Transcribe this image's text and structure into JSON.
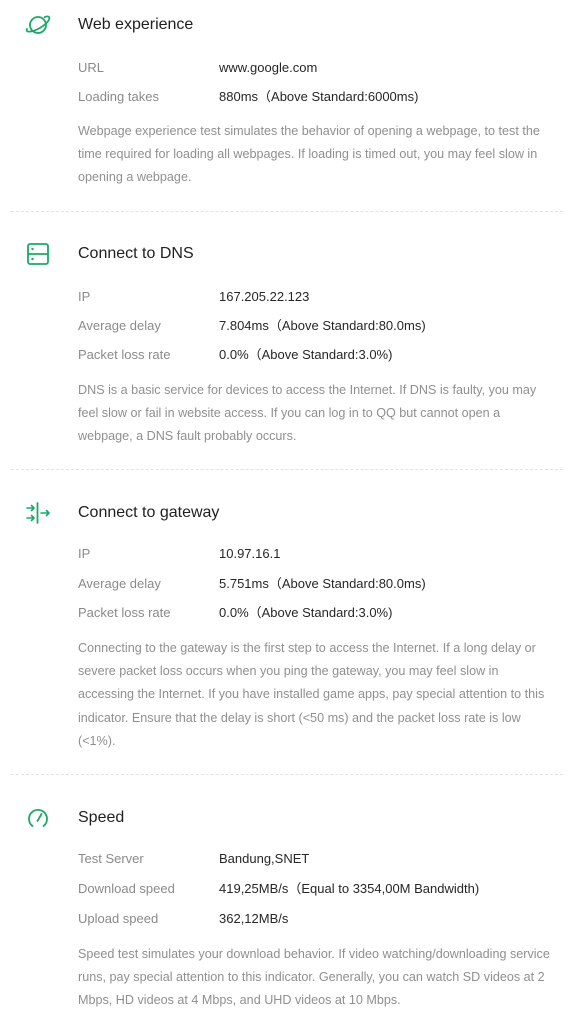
{
  "colors": {
    "accent": "#1aa96a",
    "label": "#8a8a8a",
    "value": "#262626",
    "description": "#8f8f8f",
    "divider": "#e3e3e3"
  },
  "web": {
    "icon": "planet-icon",
    "title": "Web experience",
    "url_label": "URL",
    "url_value": "www.google.com",
    "loading_label": "Loading takes",
    "loading_value": "880ms（Above Standard:6000ms)",
    "description": "Webpage experience test simulates the behavior of opening a webpage, to test the time required for loading all webpages. If loading is timed out, you may feel slow in opening a webpage."
  },
  "dns": {
    "icon": "server-icon",
    "title": "Connect to DNS",
    "ip_label": "IP",
    "ip_value": "167.205.22.123",
    "delay_label": "Average delay",
    "delay_value": "7.804ms（Above Standard:80.0ms)",
    "loss_label": "Packet loss rate",
    "loss_value": "0.0%（Above Standard:3.0%)",
    "description": "DNS is a basic service for devices to access the Internet. If DNS is faulty, you may feel slow or fail in website access. If you can log in to QQ but cannot open a webpage, a DNS fault probably occurs."
  },
  "gateway": {
    "icon": "gateway-arrows-icon",
    "title": "Connect to gateway",
    "ip_label": "IP",
    "ip_value": "10.97.16.1",
    "delay_label": "Average delay",
    "delay_value": "5.751ms（Above Standard:80.0ms)",
    "loss_label": "Packet loss rate",
    "loss_value": "0.0%（Above Standard:3.0%)",
    "description": "Connecting to the gateway is the first step to access the Internet. If a long delay or severe packet loss occurs when you ping the gateway, you may feel slow in accessing the Internet. If you have installed game apps, pay special attention to this indicator. Ensure that the delay is short (<50 ms) and the packet loss rate is low (<1%)."
  },
  "speed": {
    "icon": "speedometer-icon",
    "title": "Speed",
    "server_label": "Test Server",
    "server_value": "Bandung,SNET",
    "download_label": "Download speed",
    "download_value": "419,25MB/s（Equal to 3354,00M Bandwidth)",
    "upload_label": "Upload speed",
    "upload_value": "362,12MB/s",
    "description": "Speed test simulates your download behavior. If video watching/downloading service runs, pay special attention to this indicator. Generally, you can watch SD videos at 2 Mbps, HD videos at 4 Mbps, and UHD videos at 10 Mbps."
  }
}
